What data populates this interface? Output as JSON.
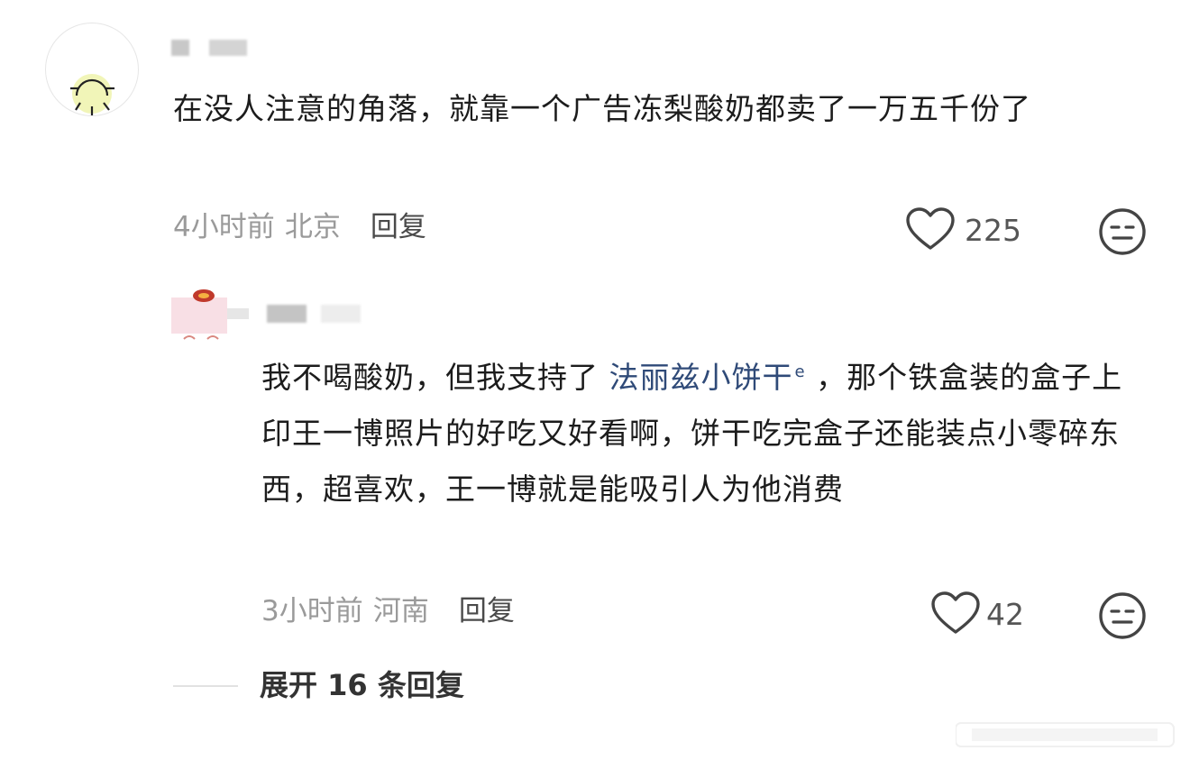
{
  "comment": {
    "text": "在没人注意的角落，就靠一个广告冻梨酸奶都卖了一万五千份了",
    "time": "4小时前",
    "location": "北京",
    "reply_label": "回复",
    "likes": "225"
  },
  "reply": {
    "text_before": "我不喝酸奶，但我支持了 ",
    "link_text": "法丽兹小饼干",
    "text_after": " ，那个铁盒装的盒子上印王一博照片的好吃又好看啊，饼干吃完盒子还能装点小零碎东西，超喜欢，王一博就是能吸引人为他消费",
    "time": "3小时前",
    "location": "河南",
    "reply_label": "回复",
    "likes": "42"
  },
  "expand_label": "展开 16 条回复",
  "icons": {
    "like": "heart-outline-icon",
    "react": "neutral-face-icon",
    "link": "search-icon",
    "avatar_main": "sun-avatar-icon"
  },
  "colors": {
    "link": "#2f4a78",
    "meta": "#9a9a9a",
    "text": "#1c1c1c"
  }
}
